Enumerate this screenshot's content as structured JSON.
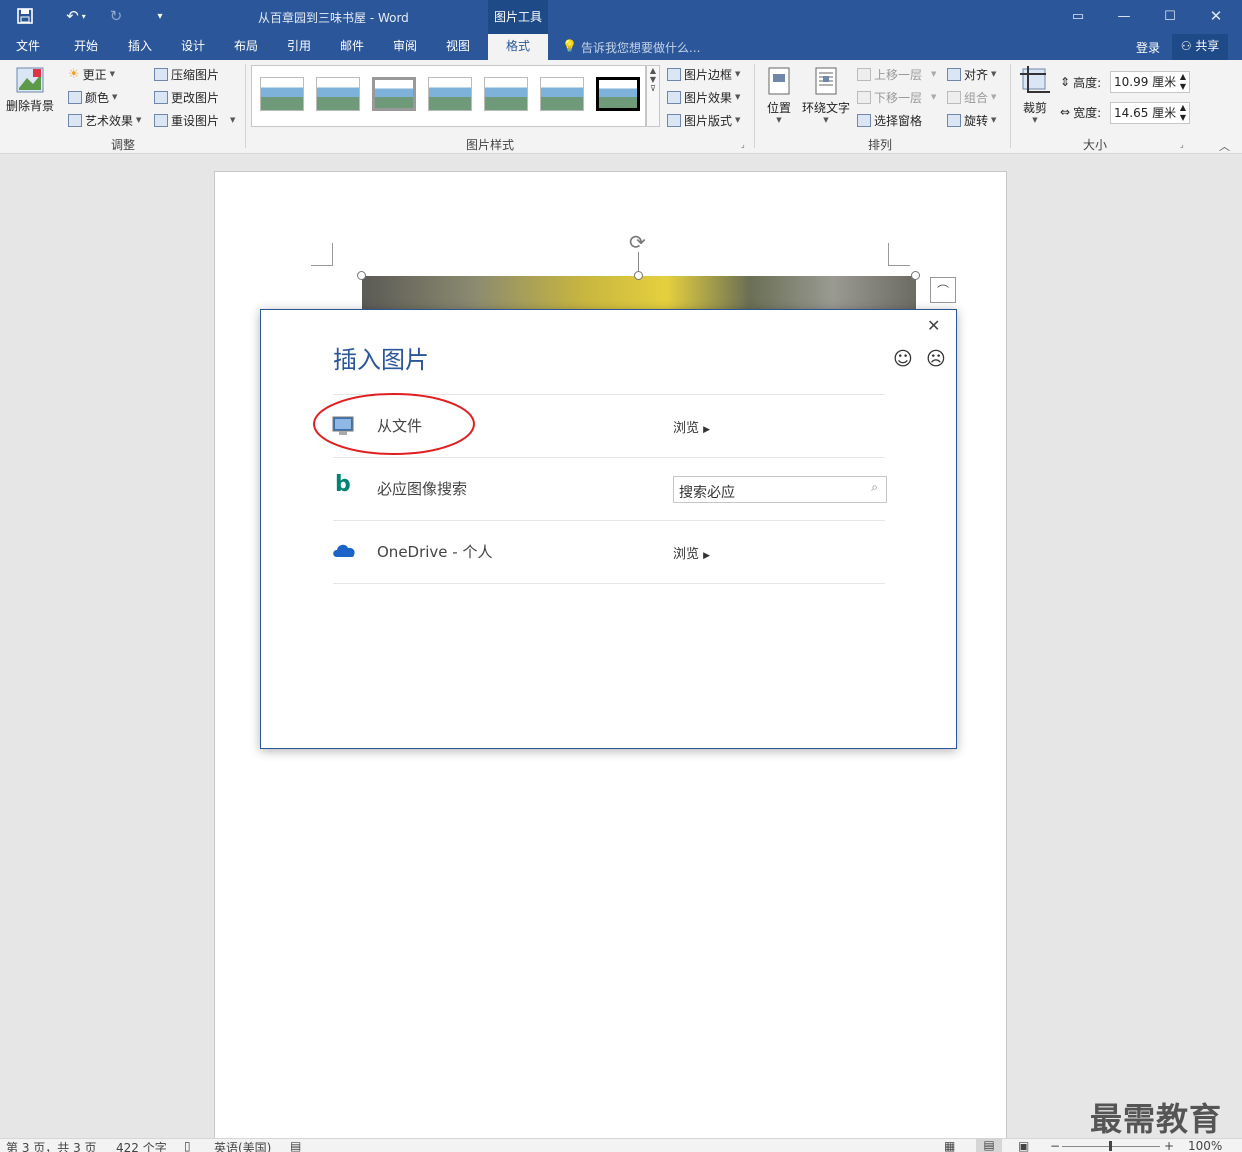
{
  "title_bar": {
    "document_title": "从百章园到三味书屋 - Word",
    "context_tool": "图片工具",
    "window_controls": [
      "ribbon-options-icon",
      "minimize-icon",
      "maximize-icon",
      "close-icon"
    ]
  },
  "tabs": [
    {
      "label": "文件"
    },
    {
      "label": "开始"
    },
    {
      "label": "插入"
    },
    {
      "label": "设计"
    },
    {
      "label": "布局"
    },
    {
      "label": "引用"
    },
    {
      "label": "邮件"
    },
    {
      "label": "审阅"
    },
    {
      "label": "视图"
    },
    {
      "label": "格式",
      "active": true
    }
  ],
  "tell_me": "告诉我您想要做什么...",
  "account": {
    "signin": "登录",
    "share": "共享"
  },
  "ribbon": {
    "adjust": {
      "remove_bg": "删除背景",
      "corrections": "更正",
      "color": "颜色",
      "artistic": "艺术效果",
      "compress": "压缩图片",
      "change": "更改图片",
      "reset": "重设图片",
      "group_label": "调整"
    },
    "styles": {
      "border": "图片边框",
      "effects": "图片效果",
      "layout": "图片版式",
      "group_label": "图片样式"
    },
    "arrange": {
      "position": "位置",
      "wrap": "环绕文字",
      "forward": "上移一层",
      "backward": "下移一层",
      "selection_pane": "选择窗格",
      "align": "对齐",
      "group": "组合",
      "rotate": "旋转",
      "group_label": "排列"
    },
    "size": {
      "crop": "裁剪",
      "height_label": "高度:",
      "height_value": "10.99 厘米",
      "width_label": "宽度:",
      "width_value": "14.65 厘米",
      "group_label": "大小"
    }
  },
  "dialog": {
    "title": "插入图片",
    "rows": [
      {
        "label": "从文件",
        "action": "浏览"
      },
      {
        "label": "必应图像搜索",
        "search_placeholder": "搜索必应"
      },
      {
        "label": "OneDrive - 个人",
        "action": "浏览"
      }
    ]
  },
  "status": {
    "page": "第 3 页，共 3 页",
    "words": "422 个字",
    "language": "英语(美国)",
    "zoom": "100%"
  },
  "watermark": "最需教育",
  "colors": {
    "accent": "#2b579a",
    "highlight_circle": "#e02020"
  }
}
